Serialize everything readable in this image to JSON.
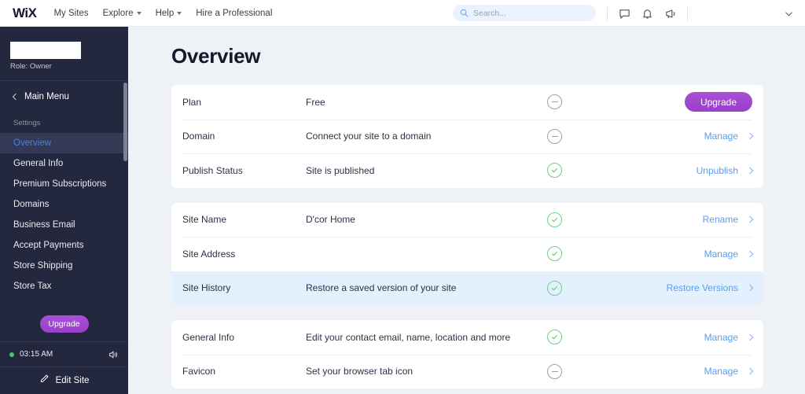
{
  "topbar": {
    "logo": "WiX",
    "nav": [
      {
        "label": "My Sites",
        "caret": false
      },
      {
        "label": "Explore",
        "caret": true
      },
      {
        "label": "Help",
        "caret": true
      },
      {
        "label": "Hire a Professional",
        "caret": false
      }
    ],
    "search": {
      "placeholder": "Search...",
      "value": ""
    },
    "icons": [
      "chat-bubble-icon",
      "bell-icon",
      "megaphone-icon",
      "chevron-down-icon"
    ]
  },
  "sidebar": {
    "site_name": "",
    "role": "Role: Owner",
    "main_menu": "Main Menu",
    "section_label": "Settings",
    "items": [
      {
        "label": "Overview",
        "active": true
      },
      {
        "label": "General Info",
        "active": false
      },
      {
        "label": "Premium Subscriptions",
        "active": false
      },
      {
        "label": "Domains",
        "active": false
      },
      {
        "label": "Business Email",
        "active": false
      },
      {
        "label": "Accept Payments",
        "active": false
      },
      {
        "label": "Store Shipping",
        "active": false
      },
      {
        "label": "Store Tax",
        "active": false
      }
    ],
    "upgrade_label": "Upgrade",
    "time": "03:15 AM",
    "edit_site_label": "Edit Site",
    "accent_purple": "#a348cf",
    "active_link_color": "#4a7fe0",
    "online_dot_color": "#4cc36e",
    "background": "#24283e"
  },
  "main": {
    "title": "Overview",
    "cards": [
      {
        "rows": [
          {
            "label": "Plan",
            "value": "Free",
            "status": "dash",
            "action_type": "button",
            "action": "Upgrade",
            "highlight": false
          },
          {
            "label": "Domain",
            "value": "Connect your site to a domain",
            "status": "dash",
            "action_type": "link",
            "action": "Manage",
            "highlight": false
          },
          {
            "label": "Publish Status",
            "value": "Site is published",
            "status": "check",
            "action_type": "link",
            "action": "Unpublish",
            "highlight": false
          }
        ]
      },
      {
        "rows": [
          {
            "label": "Site Name",
            "value": "D'cor Home",
            "status": "check",
            "action_type": "link",
            "action": "Rename",
            "highlight": false
          },
          {
            "label": "Site Address",
            "value": "",
            "status": "check",
            "action_type": "link",
            "action": "Manage",
            "highlight": false
          },
          {
            "label": "Site History",
            "value": "Restore a saved version of your site",
            "status": "check",
            "action_type": "link",
            "action": "Restore Versions",
            "highlight": true
          }
        ]
      },
      {
        "rows": [
          {
            "label": "General Info",
            "value": "Edit your contact email, name, location and more",
            "status": "check",
            "action_type": "link",
            "action": "Manage",
            "highlight": false
          },
          {
            "label": "Favicon",
            "value": "Set your browser tab icon",
            "status": "dash",
            "action_type": "link",
            "action": "Manage",
            "highlight": false
          }
        ]
      }
    ],
    "status_ok_color": "#6fcf7f",
    "status_none_color": "#9aa1b1",
    "link_color": "#5b9df2",
    "background": "#eef1f6"
  }
}
